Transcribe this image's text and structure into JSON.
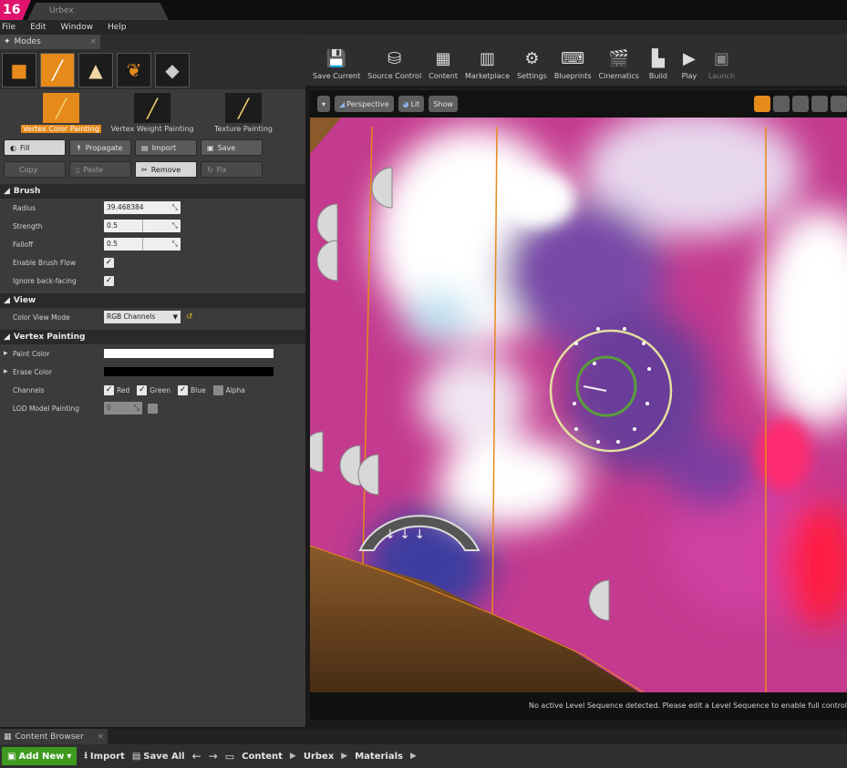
{
  "window": {
    "app_badge": "16",
    "doc_tab_label": "Urbex",
    "menu": [
      "File",
      "Edit",
      "Window",
      "Help"
    ]
  },
  "modes_panel": {
    "tab_label": "Modes",
    "mode_icons": [
      "place-mode-icon",
      "paint-mode-icon",
      "landscape-mode-icon",
      "foliage-mode-icon",
      "geometry-mode-icon"
    ],
    "paint_modes": [
      "Vertex Color Painting",
      "Vertex Weight Painting",
      "Texture Painting"
    ],
    "buttons_row1": [
      "Fill",
      "Propagate",
      "Import",
      "Save"
    ],
    "buttons_row2": [
      "Copy",
      "Paste",
      "Remove",
      "Fix"
    ],
    "brush": {
      "title": "Brush",
      "radius_label": "Radius",
      "radius_value": "39.468384",
      "strength_label": "Strength",
      "strength_value": "0.5",
      "falloff_label": "Falloff",
      "falloff_value": "0.5",
      "flow_label": "Enable Brush Flow",
      "backface_label": "Ignore back-facing"
    },
    "view": {
      "title": "View",
      "color_view_label": "Color View Mode",
      "color_view_value": "RGB Channels"
    },
    "vertex_painting": {
      "title": "Vertex Painting",
      "paint_color_label": "Paint Color",
      "erase_color_label": "Erase Color",
      "channels_label": "Channels",
      "channels": [
        "Red",
        "Green",
        "Blue",
        "Alpha"
      ],
      "lod_label": "LOD Model Painting",
      "lod_value": "0"
    }
  },
  "toolbar": {
    "items": [
      "Save Current",
      "Source Control",
      "Content",
      "Marketplace",
      "Settings",
      "Blueprints",
      "Cinematics",
      "Build",
      "Play",
      "Launch"
    ]
  },
  "viewport": {
    "perspective_label": "Perspective",
    "lit_label": "Lit",
    "show_label": "Show",
    "status_text": "No active Level Sequence detected. Please edit a Level Sequence to enable full controls"
  },
  "content_browser": {
    "tab_label": "Content Browser",
    "add_new_label": "Add New",
    "import_label": "Import",
    "save_all_label": "Save All",
    "breadcrumb": [
      "Content",
      "Urbex",
      "Materials"
    ]
  },
  "colors": {
    "accent": "#e58a1b",
    "badge": "#e0146e",
    "add_new": "#3e9a1e",
    "paint_color": "#ffffff",
    "erase_color": "#000000"
  }
}
